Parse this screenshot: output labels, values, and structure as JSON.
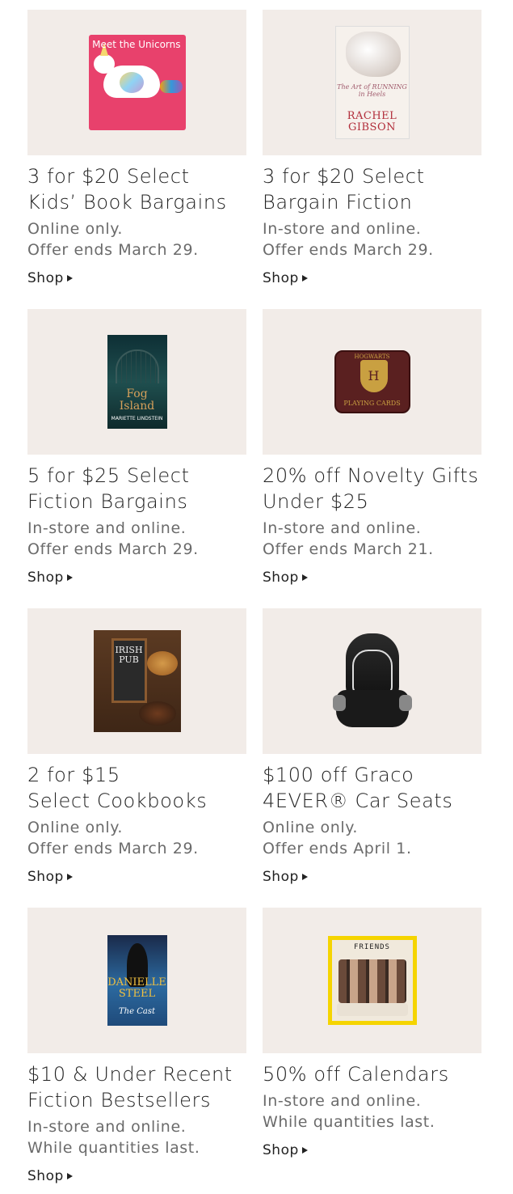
{
  "promos": [
    {
      "title_line1": "3 for $20 Select",
      "title_line2": "Kids’ Book Bargains",
      "sub_line1": "Online only.",
      "sub_line2": "Offer ends March 29.",
      "shop_label": "Shop",
      "image_text": "Meet the Unicorns"
    },
    {
      "title_line1": "3 for $20 Select",
      "title_line2": "Bargain Fiction",
      "sub_line1": "In-store and online.",
      "sub_line2": "Offer ends March 29.",
      "shop_label": "Shop",
      "image_text_top": "The Art of RUNNING in Heels",
      "image_text_author": "RACHEL GIBSON"
    },
    {
      "title_line1": "5 for $25 Select",
      "title_line2": "Fiction Bargains",
      "sub_line1": "In-store and online.",
      "sub_line2": "Offer ends March 29.",
      "shop_label": "Shop",
      "image_text": "Fog Island",
      "image_author": "MARIETTE LINDSTEIN"
    },
    {
      "title_line1": "20% off Novelty Gifts",
      "title_line2": "Under $25",
      "sub_line1": "In-store and online.",
      "sub_line2": "Offer ends March 21.",
      "shop_label": "Shop",
      "image_text_top": "HOGWARTS",
      "image_text": "PLAYING CARDS"
    },
    {
      "title_line1": "2 for $15",
      "title_line2": "Select Cookbooks",
      "sub_line1": "Online only.",
      "sub_line2": "Offer ends March 29.",
      "shop_label": "Shop",
      "image_text": "IRISH PUB"
    },
    {
      "title_line1": "$100 off  Graco",
      "title_line2": "4EVER® Car Seats",
      "sub_line1": "Online only.",
      "sub_line2": "Offer ends April 1.",
      "shop_label": "Shop"
    },
    {
      "title_line1": "$10 & Under Recent",
      "title_line2": "Fiction Bestsellers",
      "sub_line1": "In-store and online.",
      "sub_line2": "While quantities last.",
      "shop_label": "Shop",
      "image_text": "DANIELLE STEEL",
      "image_sub": "The Cast"
    },
    {
      "title_line1": "50% off Calendars",
      "title_line2": "",
      "sub_line1": "In-store and online.",
      "sub_line2": "While quantities last.",
      "shop_label": "Shop",
      "image_text": "FRIENDS"
    }
  ]
}
